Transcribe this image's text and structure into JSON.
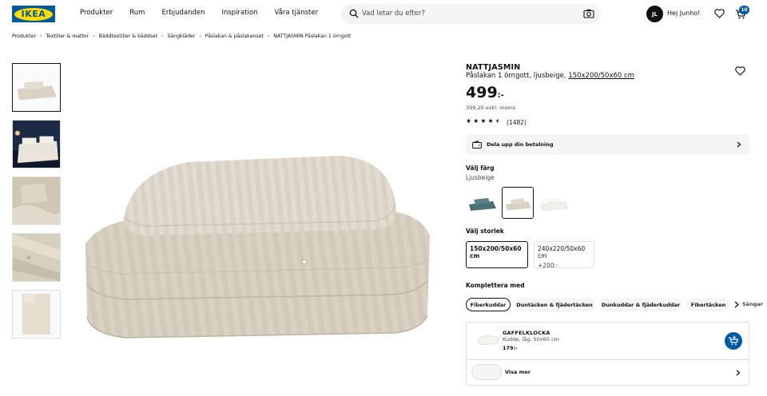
{
  "header": {
    "logo": "IKEA",
    "nav": [
      "Produkter",
      "Rum",
      "Erbjudanden",
      "Inspiration",
      "Våra tjänster"
    ],
    "search_placeholder": "Vad letar du efter?",
    "user_initials": "JL",
    "greeting": "Hej Junho!",
    "cart_count": "10"
  },
  "breadcrumb": [
    "Produkter",
    "Textilier & mattor",
    "Bäddtextilier & bäddset",
    "Sängkläder",
    "Påslakan & påslakanset",
    "NATTJASMIN Påslakan 1 örngott"
  ],
  "product": {
    "name": "NATTJASMIN",
    "description": "Påslakan 1 örngott, ljusbeige,",
    "size_link": "150x200/50x60 cm",
    "price": "499",
    "price_suffix": ":-",
    "price_ex_vat": "399,20 exkl. moms",
    "rating": 4.5,
    "reviews": "(1482)",
    "pay_split": "Dela upp din betalning"
  },
  "color": {
    "label": "Välj färg",
    "selected": "Ljusbeige",
    "options": [
      "dark-teal",
      "light-beige",
      "white"
    ]
  },
  "sizes": {
    "label": "Välj storlek",
    "options": [
      {
        "size": "150x200/50x60 cm",
        "extra": ""
      },
      {
        "size": "240x220/50x60 cm",
        "extra": "+200:-"
      }
    ]
  },
  "complement": {
    "label": "Komplettera med",
    "pills": [
      "Fiberkuddar",
      "Duntäcken & fjädertäcken",
      "Dunkuddar & fjäderkuddar",
      "Fibertäcken",
      "Sängar"
    ]
  },
  "recommendation": {
    "name": "GAFFELKLOCKA",
    "desc": "Kudde, låg, 50x60 cm",
    "price": "179:-",
    "more": "Visa mer"
  },
  "colors": {
    "brand_blue": "#0058a3",
    "brand_yellow": "#ffdb00",
    "beige": "#d9d1c4"
  }
}
